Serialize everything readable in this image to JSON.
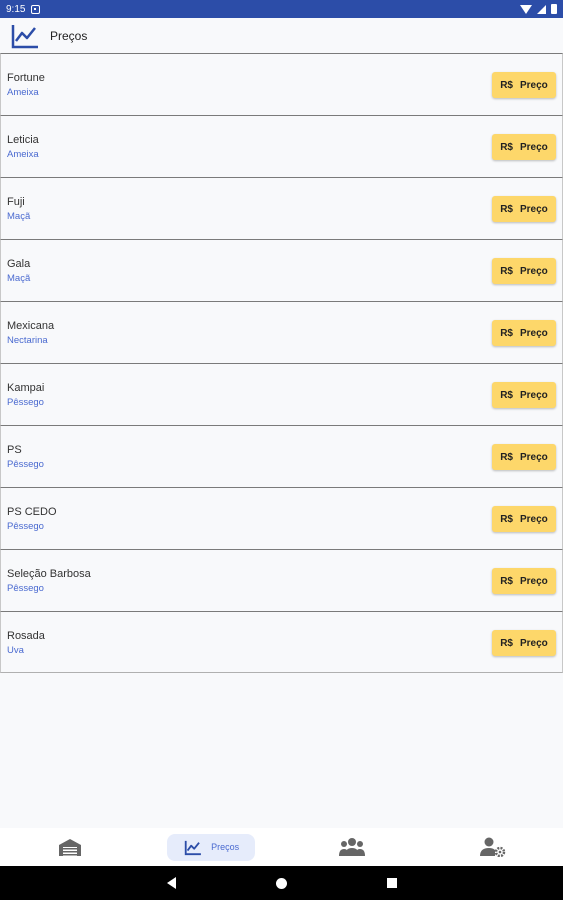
{
  "status_bar": {
    "time": "9:15"
  },
  "header": {
    "title": "Preços"
  },
  "items": [
    {
      "name": "Fortune",
      "category": "Ameixa",
      "currency": "R$",
      "button": "Preço"
    },
    {
      "name": "Leticia",
      "category": "Ameixa",
      "currency": "R$",
      "button": "Preço"
    },
    {
      "name": "Fuji",
      "category": "Maçã",
      "currency": "R$",
      "button": "Preço"
    },
    {
      "name": "Gala",
      "category": "Maçã",
      "currency": "R$",
      "button": "Preço"
    },
    {
      "name": "Mexicana",
      "category": "Nectarina",
      "currency": "R$",
      "button": "Preço"
    },
    {
      "name": "Kampai",
      "category": "Pêssego",
      "currency": "R$",
      "button": "Preço"
    },
    {
      "name": "PS",
      "category": "Pêssego",
      "currency": "R$",
      "button": "Preço"
    },
    {
      "name": "PS CEDO",
      "category": "Pêssego",
      "currency": "R$",
      "button": "Preço"
    },
    {
      "name": "Seleção Barbosa",
      "category": "Pêssego",
      "currency": "R$",
      "button": "Preço"
    },
    {
      "name": "Rosada",
      "category": "Uva",
      "currency": "R$",
      "button": "Preço"
    }
  ],
  "bottom_nav": {
    "items": [
      {
        "icon": "warehouse-icon",
        "label": ""
      },
      {
        "icon": "chart-line-icon",
        "label": "Preços",
        "active": true
      },
      {
        "icon": "users-icon",
        "label": ""
      },
      {
        "icon": "user-settings-icon",
        "label": ""
      }
    ]
  },
  "colors": {
    "status_bar": "#2c4da8",
    "accent": "#4a6ad0",
    "button": "#fdd76a"
  }
}
